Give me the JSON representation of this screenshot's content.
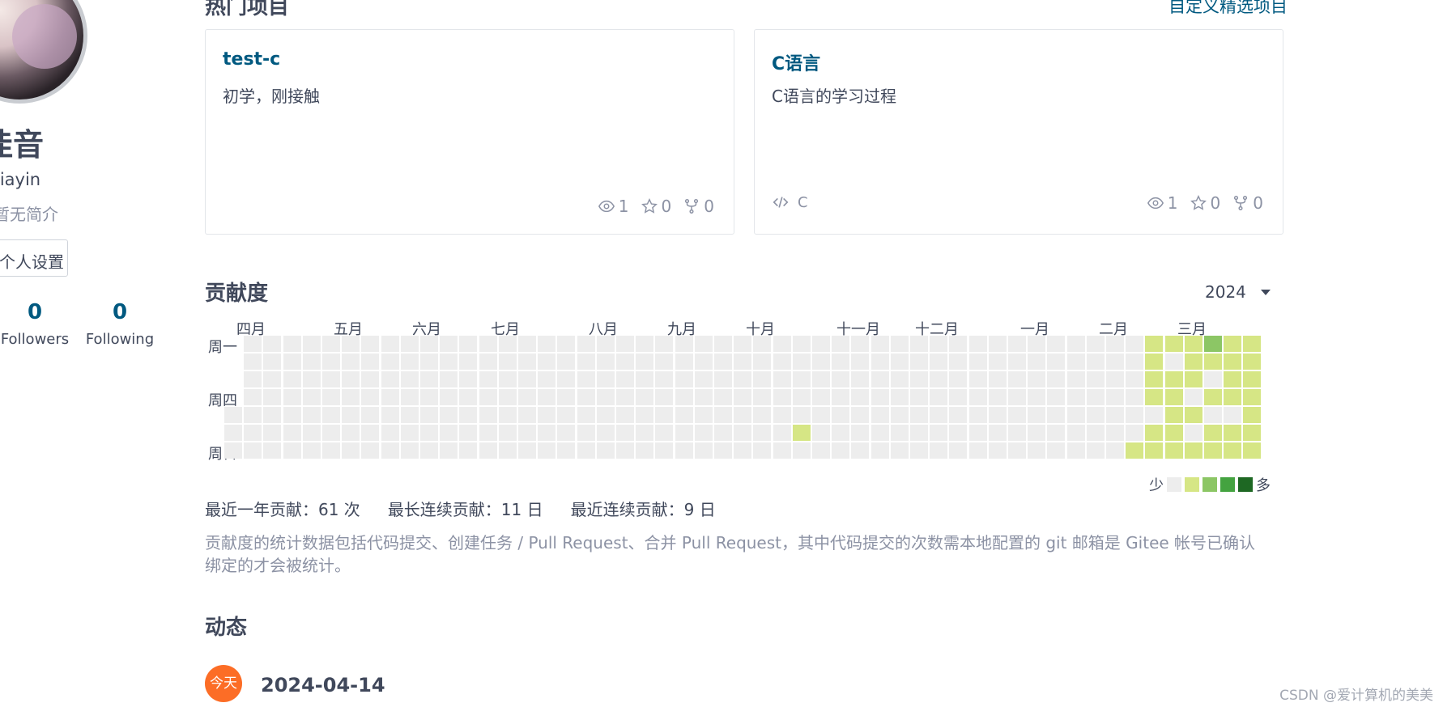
{
  "profile": {
    "name_partial": "佳音",
    "username_partial": "jiayin",
    "bio_partial": "暂无简介",
    "settings_label": "个人设置",
    "stats": [
      {
        "value": "0",
        "label": "Followers"
      },
      {
        "value": "0",
        "label": "Following"
      }
    ]
  },
  "popular": {
    "title": "热门项目",
    "custom_link": "自定义精选项目",
    "cards": [
      {
        "name": "test-c",
        "desc": "初学，刚接触",
        "lang": "",
        "watch": "1",
        "star": "0",
        "fork": "0"
      },
      {
        "name": "C语言",
        "desc": "C语言的学习过程",
        "lang": "C",
        "watch": "1",
        "star": "0",
        "fork": "0"
      }
    ]
  },
  "contribution": {
    "title": "贡献度",
    "year": "2024",
    "months": [
      "四月",
      "五月",
      "六月",
      "七月",
      "八月",
      "九月",
      "十月",
      "十一月",
      "十二月",
      "一月",
      "二月",
      "三月"
    ],
    "weekdays": [
      "周一",
      "周四",
      "周日"
    ],
    "legend_less": "少",
    "legend_more": "多",
    "colors": [
      "#ededed",
      "#d6e685",
      "#8cc665",
      "#44a340",
      "#1e6823"
    ],
    "summary": {
      "year_total": "最近一年贡献：61 次",
      "longest": "最长连续贡献：11 日",
      "recent": "最近连续贡献：9 日"
    },
    "note": "贡献度的统计数据包括代码提交、创建任务 / Pull Request、合并 Pull Request，其中代码提交的次数需本地配置的 git 邮箱是 Gitee 帐号已确认绑定的才会被统计。"
  },
  "activity": {
    "title": "动态",
    "badge": "今天",
    "date": "2024-04-14"
  },
  "watermark": "CSDN @爱计算机的美美"
}
